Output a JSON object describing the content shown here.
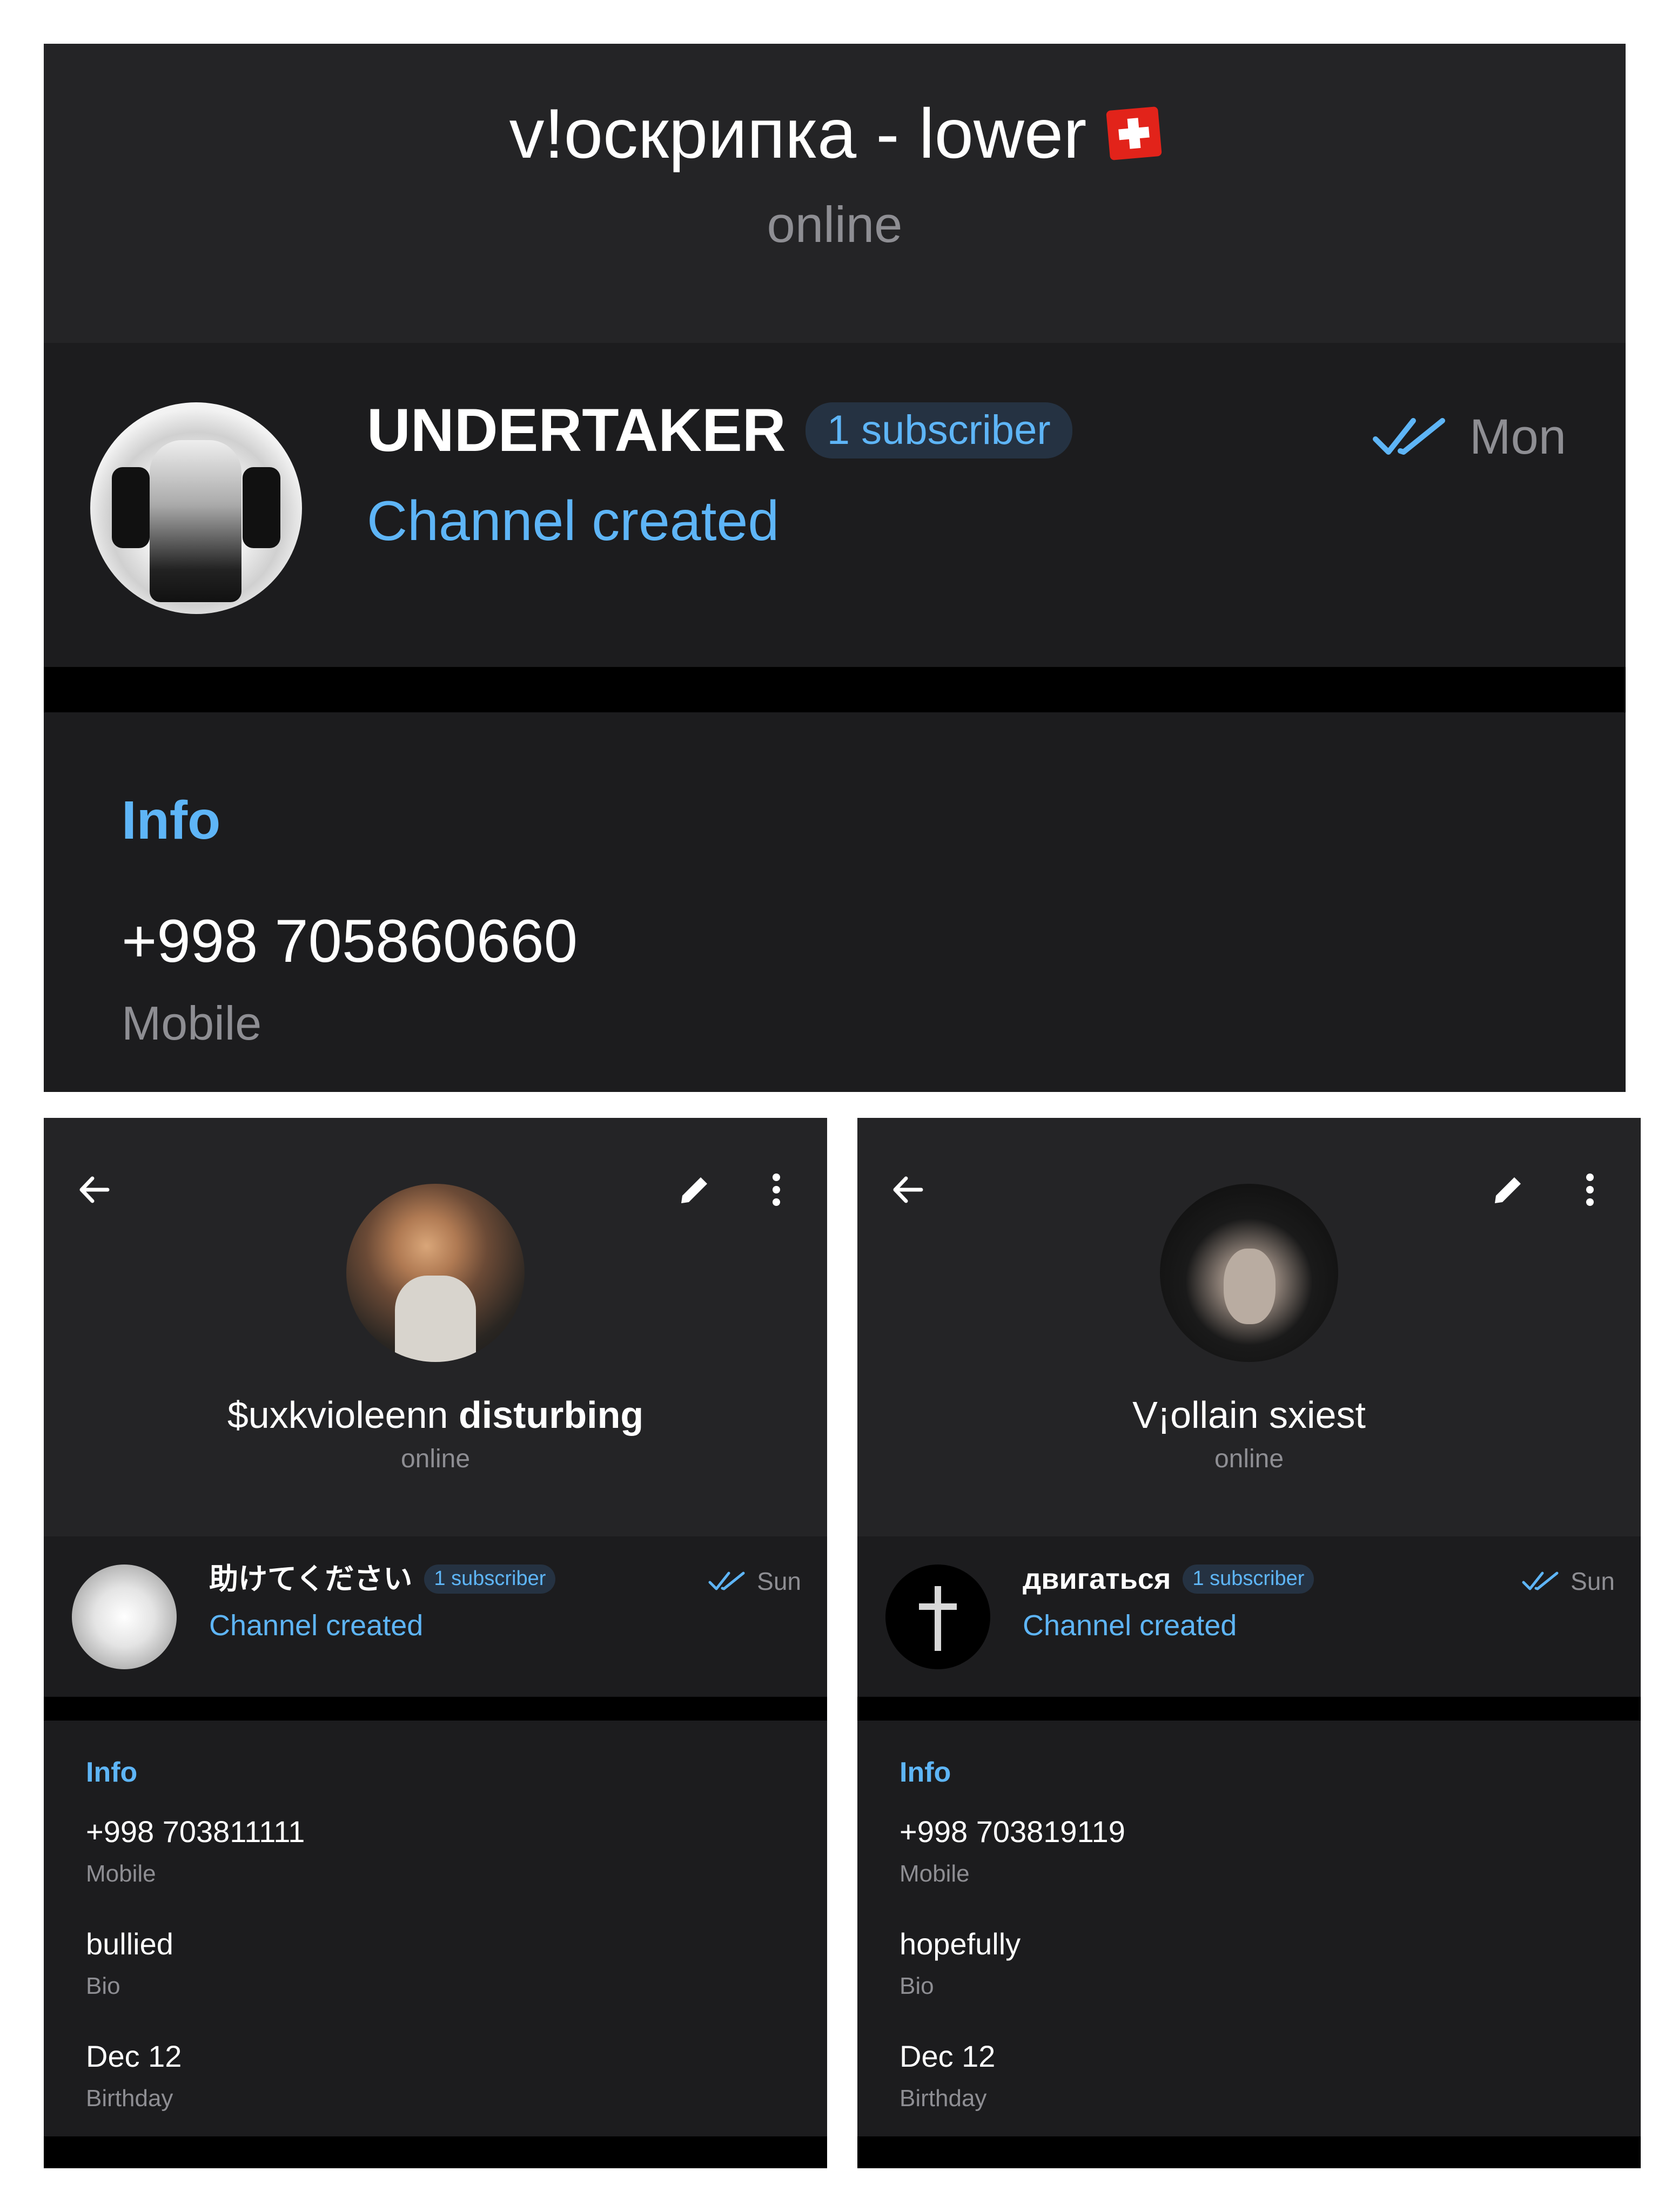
{
  "top": {
    "title": "v!оскрипка - lower",
    "status": "online",
    "channel": {
      "name": "UNDERTAKER",
      "badge": "1 subscriber",
      "subtitle": "Channel created",
      "time": "Mon"
    },
    "info": {
      "title": "Info",
      "phone": "+998 705860660",
      "phone_label": "Mobile"
    }
  },
  "left": {
    "name": "$uxkvioleenn",
    "name_bold": "disturbing",
    "status": "online",
    "channel": {
      "name": "助けてください",
      "badge": "1 subscriber",
      "subtitle": "Channel created",
      "time": "Sun"
    },
    "info": {
      "title": "Info",
      "phone": "+998 703811111",
      "phone_label": "Mobile",
      "bio": "bullied",
      "bio_label": "Bio",
      "birthday": "Dec 12",
      "birthday_label": "Birthday"
    }
  },
  "right": {
    "name": "V¡ollain sxiest",
    "status": "online",
    "channel": {
      "name": "двигаться",
      "badge": "1 subscriber",
      "subtitle": "Channel created",
      "time": "Sun"
    },
    "info": {
      "title": "Info",
      "phone": "+998 703819119",
      "phone_label": "Mobile",
      "bio": "hopefully",
      "bio_label": "Bio",
      "birthday": "Dec 12",
      "birthday_label": "Birthday"
    }
  },
  "icons": {
    "flag": "swiss-flag-icon",
    "read": "double-check-icon",
    "back": "arrow-left-icon",
    "edit": "pencil-icon",
    "more": "more-vertical-icon"
  },
  "colors": {
    "accent": "#5eb5f7",
    "bg": "#1c1c1e",
    "header_bg": "#242426",
    "muted": "#8e8e93"
  }
}
